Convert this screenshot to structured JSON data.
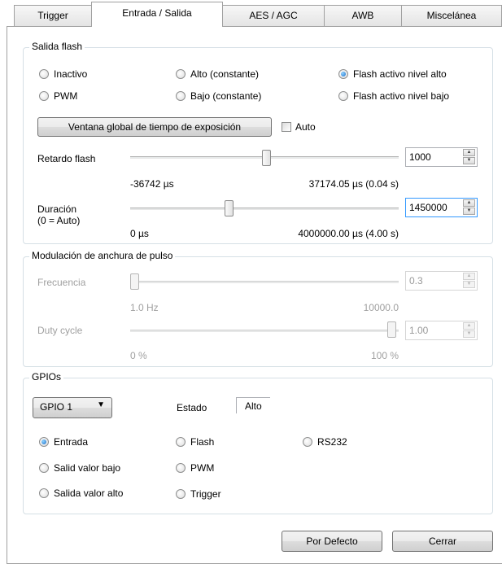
{
  "tabs": [
    {
      "label": "Trigger"
    },
    {
      "label": "Entrada / Salida"
    },
    {
      "label": "AES / AGC"
    },
    {
      "label": "AWB"
    },
    {
      "label": "Miscelánea"
    }
  ],
  "active_tab": "Entrada / Salida",
  "flash_output": {
    "title": "Salida flash",
    "options": {
      "inactive": {
        "label": "Inactivo",
        "selected": false
      },
      "high_constant": {
        "label": "Alto (constante)",
        "selected": false
      },
      "flash_active_high": {
        "label": "Flash activo nivel alto",
        "selected": true
      },
      "pwm": {
        "label": "PWM",
        "selected": false
      },
      "low_constant": {
        "label": "Bajo (constante)",
        "selected": false
      },
      "flash_active_low": {
        "label": "Flash activo nivel bajo",
        "selected": false
      }
    },
    "global_exposure_button": "Ventana global de tiempo de exposición",
    "auto_checkbox": {
      "label": "Auto",
      "checked": false
    },
    "delay": {
      "label": "Retardo flash",
      "value": "1000",
      "min_label": "-36742 µs",
      "max_label": "37174.05 µs  (0.04 s)",
      "slider_fraction": 0.51
    },
    "duration": {
      "label_line1": "Duración",
      "label_line2": "(0 = Auto)",
      "value": "1450000",
      "min_label": "0 µs",
      "max_label": "4000000.00 µs  (4.00 s)",
      "slider_fraction": 0.36
    }
  },
  "pwm": {
    "title": "Modulación de anchura de pulso",
    "frequency": {
      "label": "Frecuencia",
      "value": "0.3",
      "min_label": "1.0 Hz",
      "max_label": "10000.0",
      "slider_fraction": 0.0
    },
    "duty_cycle": {
      "label": "Duty cycle",
      "value": "1.00",
      "min_label": "0 %",
      "max_label": "100 %",
      "slider_fraction": 1.0
    }
  },
  "gpios": {
    "title": "GPIOs",
    "selected_gpio": "GPIO 1",
    "state_label": "Estado",
    "state_value": "Alto",
    "options": {
      "input": {
        "label": "Entrada",
        "selected": true
      },
      "flash": {
        "label": "Flash",
        "selected": false
      },
      "rs232": {
        "label": "RS232",
        "selected": false
      },
      "output_low": {
        "label": "Salid valor bajo",
        "selected": false
      },
      "pwm": {
        "label": "PWM",
        "selected": false
      },
      "output_high": {
        "label": "Salida valor alto",
        "selected": false
      },
      "trigger": {
        "label": "Trigger",
        "selected": false
      }
    }
  },
  "buttons": {
    "defaults": "Por Defecto",
    "close": "Cerrar"
  }
}
